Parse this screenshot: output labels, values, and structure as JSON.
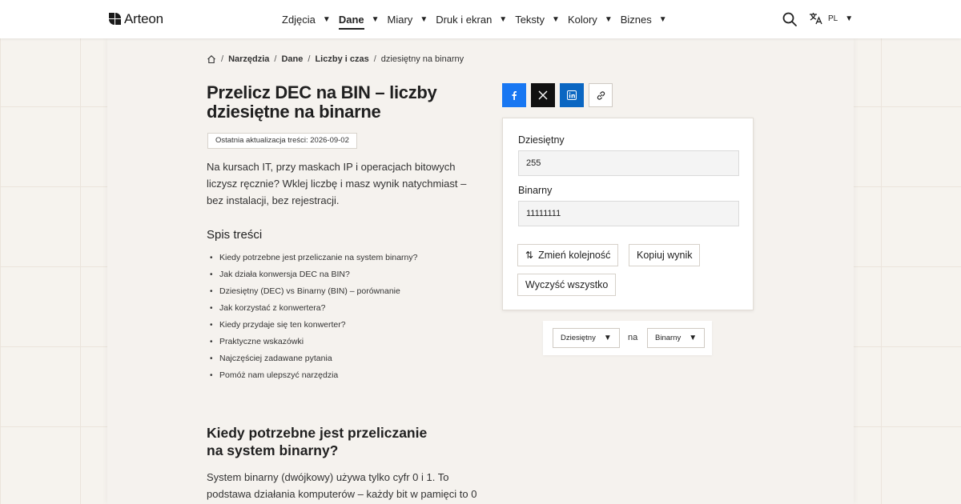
{
  "header": {
    "logo": "Arteon",
    "nav": [
      {
        "label": "Zdjęcia",
        "active": false
      },
      {
        "label": "Dane",
        "active": true
      },
      {
        "label": "Miary",
        "active": false
      },
      {
        "label": "Druk i ekran",
        "active": false
      },
      {
        "label": "Teksty",
        "active": false
      },
      {
        "label": "Kolory",
        "active": false
      },
      {
        "label": "Biznes",
        "active": false
      }
    ],
    "search_icon": "search-icon",
    "language": "PL"
  },
  "breadcrumb": {
    "home_icon": "home-icon",
    "items": [
      "Narzędzia",
      "Dane",
      "Liczby i czas"
    ],
    "current": "dziesiętny na binarny"
  },
  "page": {
    "title": "Przelicz DEC na BIN – liczby dziesiętne na binarne",
    "updated": "Ostatnia aktualizacja treści: 2026-09-02",
    "intro": "Na kursach IT, przy maskach IP i operacjach bitowych liczysz ręcznie? Wklej liczbę i masz wynik natychmiast – bez instalacji, bez rejestracji.",
    "toc_title": "Spis treści",
    "toc": [
      "Kiedy potrzebne jest przeliczanie na system binarny?",
      "Jak działa konwersja DEC na BIN?",
      "Dziesiętny (DEC) vs Binarny (BIN) – porównanie",
      "Jak korzystać z konwertera?",
      "Kiedy przydaje się ten konwerter?",
      "Praktyczne wskazówki",
      "Najczęściej zadawane pytania",
      "Pomóż nam ulepszyć narzędzia"
    ],
    "section_title": "Kiedy potrzebne jest przeliczanie na system binarny?",
    "section_text": "System binarny (dwójkowy) używa tylko cyfr 0 i 1. To podstawa działania komputerów – każdy bit w pamięci to 0"
  },
  "share": {
    "icons": [
      "facebook-icon",
      "x-icon",
      "linkedin-icon",
      "link-icon"
    ],
    "colors": {
      "facebook": "#1877f2",
      "x": "#111111",
      "linkedin": "#0a66c2"
    }
  },
  "converter": {
    "input_label": "Dziesiętny",
    "input_value": "255",
    "output_label": "Binarny",
    "output_value": "11111111",
    "swap_label": "Zmień kolejność",
    "copy_label": "Kopiuj wynik",
    "clear_label": "Wyczyść wszystko"
  },
  "units": {
    "from": "Dziesiętny",
    "connector": "na",
    "to": "Binarny"
  }
}
